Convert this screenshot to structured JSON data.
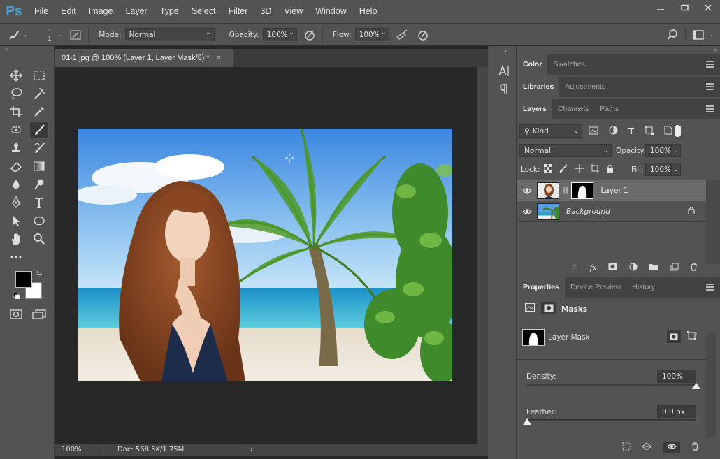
{
  "app": {
    "logo": "Ps",
    "menu": [
      "File",
      "Edit",
      "Image",
      "Layer",
      "Type",
      "Select",
      "Filter",
      "3D",
      "View",
      "Window",
      "Help"
    ],
    "window_controls": [
      "minimize-icon",
      "restore-icon",
      "close-icon"
    ]
  },
  "options_bar": {
    "brush_size": "1",
    "mode_label": "Mode:",
    "mode_value": "Normal",
    "opacity_label": "Opacity:",
    "opacity_value": "100%",
    "flow_label": "Flow:",
    "flow_value": "100%"
  },
  "document": {
    "tab_title": "01-1.jpg @ 100% (Layer 1, Layer Mask/8) *",
    "close_glyph": "×",
    "zoom": "100%",
    "doc_info": "Doc: 568.5K/1.75M"
  },
  "panels": {
    "color_group": {
      "tabs": [
        "Color",
        "Swatches"
      ],
      "active": 0
    },
    "libraries_group": {
      "tabs": [
        "Libraries",
        "Adjustments"
      ],
      "active": 0
    },
    "layers_group": {
      "tabs": [
        "Layers",
        "Channels",
        "Paths"
      ],
      "active": 0,
      "filter_kind": "Kind",
      "blend_mode": "Normal",
      "opacity_label": "Opacity:",
      "opacity_value": "100%",
      "lock_label": "Lock:",
      "fill_label": "Fill:",
      "fill_value": "100%",
      "layers": [
        {
          "name": "Layer 1",
          "selected": true,
          "has_mask": true
        },
        {
          "name": "Background",
          "selected": false,
          "locked": true
        }
      ]
    },
    "properties_group": {
      "tabs": [
        "Properties",
        "Device Preview",
        "History"
      ],
      "active": 0,
      "section_title": "Masks",
      "mask_type": "Layer Mask",
      "density_label": "Density:",
      "density_value": "100%",
      "density_level": 1.0,
      "feather_label": "Feather:",
      "feather_value": "0.0 px",
      "feather_level": 0.0
    }
  },
  "colors": {
    "accent": "#4aa3df",
    "ui_bg": "#535353",
    "canvas_bg": "#282828"
  }
}
